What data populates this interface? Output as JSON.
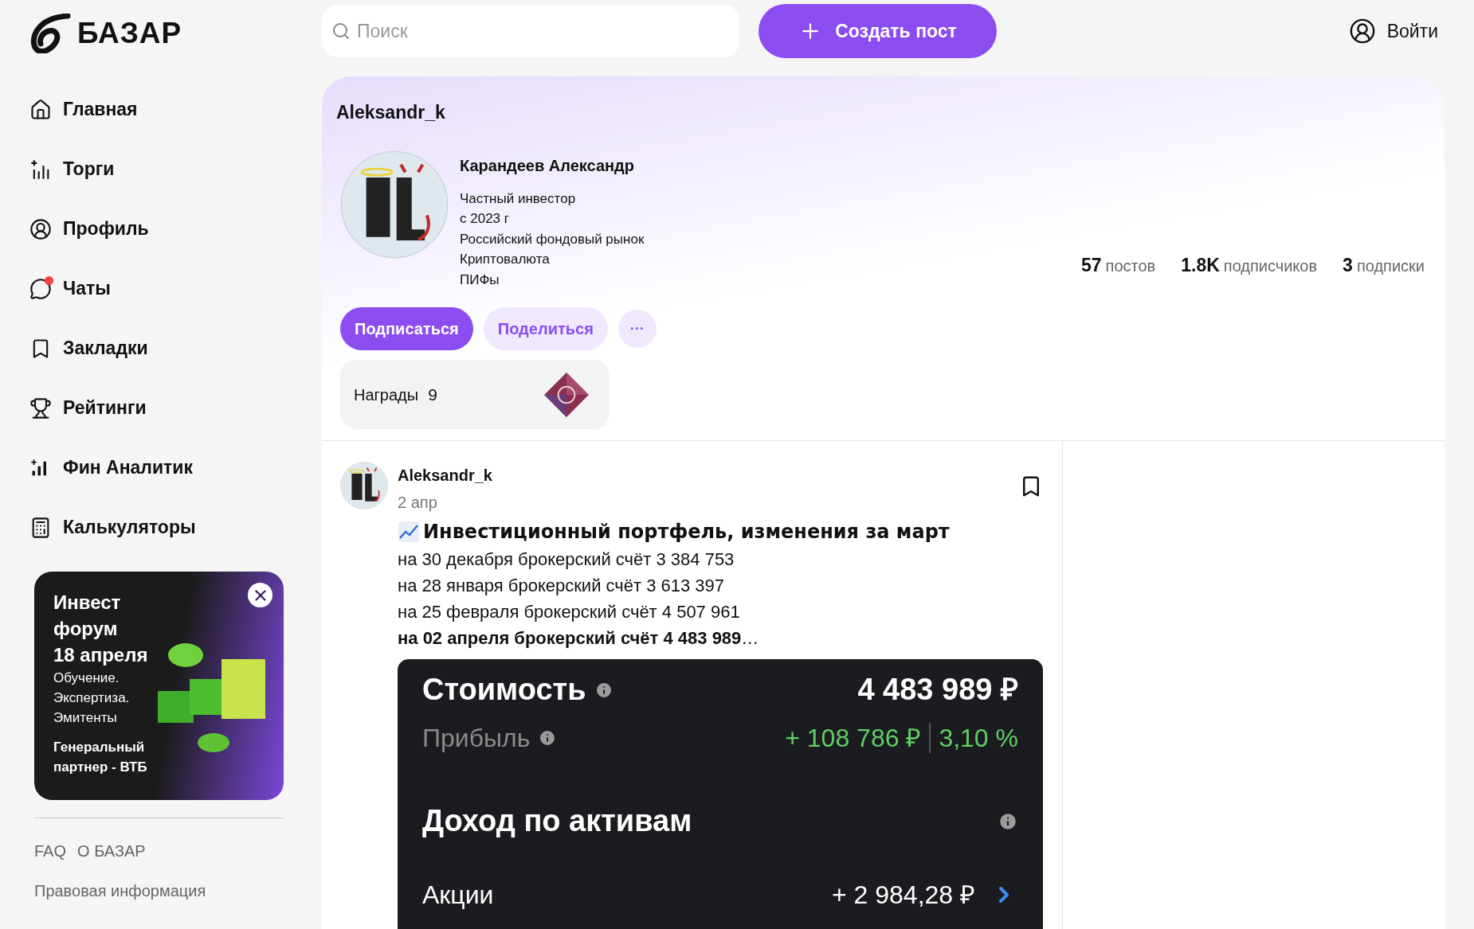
{
  "logo": {
    "text": "БАЗАР"
  },
  "search": {
    "placeholder": "Поиск"
  },
  "create_button": {
    "label": "Создать пост"
  },
  "login": {
    "label": "Войти"
  },
  "nav": [
    {
      "kind": "home",
      "label": "Главная",
      "badge": false
    },
    {
      "kind": "trades",
      "label": "Торги",
      "badge": false
    },
    {
      "kind": "profile",
      "label": "Профиль",
      "badge": false
    },
    {
      "kind": "chats",
      "label": "Чаты",
      "badge": true
    },
    {
      "kind": "bookmarks",
      "label": "Закладки",
      "badge": false
    },
    {
      "kind": "ratings",
      "label": "Рейтинги",
      "badge": false
    },
    {
      "kind": "analytics",
      "label": "Фин Аналитик",
      "badge": false
    },
    {
      "kind": "calculators",
      "label": "Калькуляторы",
      "badge": false
    }
  ],
  "promo": {
    "title_lines": [
      "Инвест",
      "форум",
      "18 апреля"
    ],
    "lines": [
      "Обучение.",
      "Экспертиза.",
      "Эмитенты"
    ],
    "partner_lines": [
      "Генеральный",
      "партнер - ВТБ"
    ]
  },
  "footer_links": [
    [
      "FAQ",
      "О БАЗАР"
    ],
    [
      "Правовая информация"
    ]
  ],
  "profile": {
    "username": "Aleksandr_k",
    "full_name": "Карандеев Александр",
    "details": [
      "Частный инвестор",
      "с 2023 г",
      "Российский фондовый рынок",
      "Криптовалюта",
      "ПИФы"
    ],
    "stats": [
      {
        "count": "57",
        "unit": "постов"
      },
      {
        "count": "1.8K",
        "unit": "подписчиков"
      },
      {
        "count": "3",
        "unit": "подписки"
      }
    ],
    "subscribe": "Подписаться",
    "share": "Поделиться",
    "more": "···",
    "awards": {
      "label": "Награды",
      "count": "9"
    }
  },
  "post": {
    "author": "Aleksandr_k",
    "date": "2 апр",
    "title": "Инвестиционный портфель, изменения за март",
    "lines": [
      "на 30 декабря брокерский счёт 3 384 753",
      "на 28 января брокерский счёт 3 613 397",
      "на 25 февраля брокерский счёт 4 507 961",
      "**на 02 апреля брокерский счёт 4 483 989**…"
    ],
    "screenshot": {
      "value_label": "Стоимость",
      "value": "4 483 989 ₽",
      "profit_label": "Прибыль",
      "profit": "+ 108 786 ₽",
      "profit_percent": "3,10 %",
      "income_title": "Доход по активам",
      "rows": [
        {
          "label": "Акции",
          "value": "+ 2 984,28 ₽"
        }
      ]
    }
  }
}
